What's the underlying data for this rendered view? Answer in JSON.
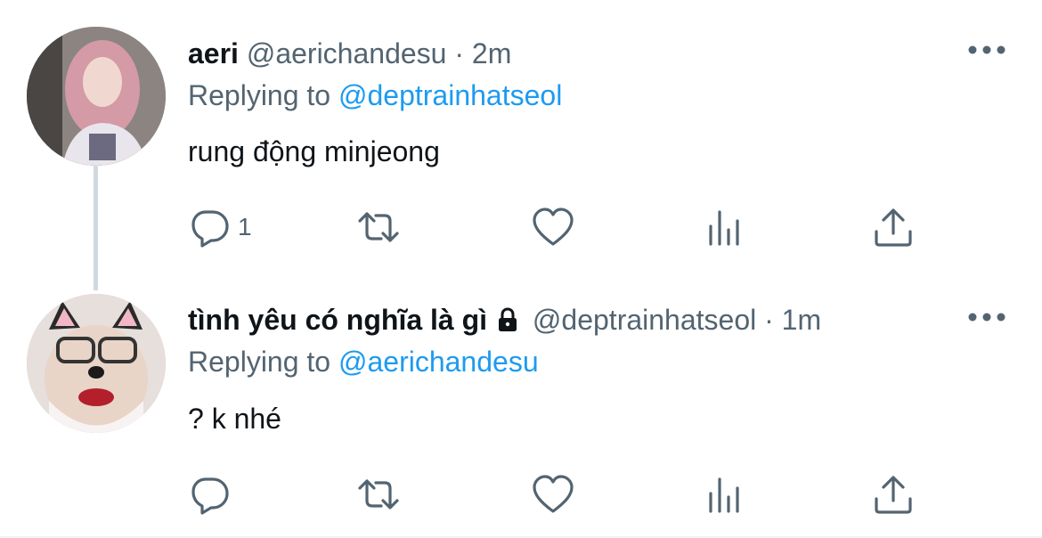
{
  "tweets": [
    {
      "name": "aeri",
      "handle": "@aerichandesu",
      "dot": "·",
      "time": "2m",
      "replying_prefix": "Replying to",
      "replying_to": "@deptrainhatseol",
      "text": "rung động minjeong",
      "reply_count": "1",
      "avatar_icon": "avatar-photo",
      "locked": false
    },
    {
      "name": "tình yêu có nghĩa là gì",
      "handle": "@deptrainhatseol",
      "dot": "·",
      "time": "1m",
      "replying_prefix": "Replying to",
      "replying_to": "@aerichandesu",
      "text": "? k nhé",
      "reply_count": "",
      "avatar_icon": "avatar-photo",
      "locked": true
    }
  ],
  "icons": {
    "reply": "reply-icon",
    "retweet": "retweet-icon",
    "like": "heart-icon",
    "views": "views-icon",
    "share": "share-icon",
    "more": "more-icon",
    "lock": "lock-icon"
  },
  "colors": {
    "text": "#0f1419",
    "secondary": "#536471",
    "link": "#1d9bf0",
    "thread_line": "#cfd9de",
    "background": "#ffffff"
  }
}
